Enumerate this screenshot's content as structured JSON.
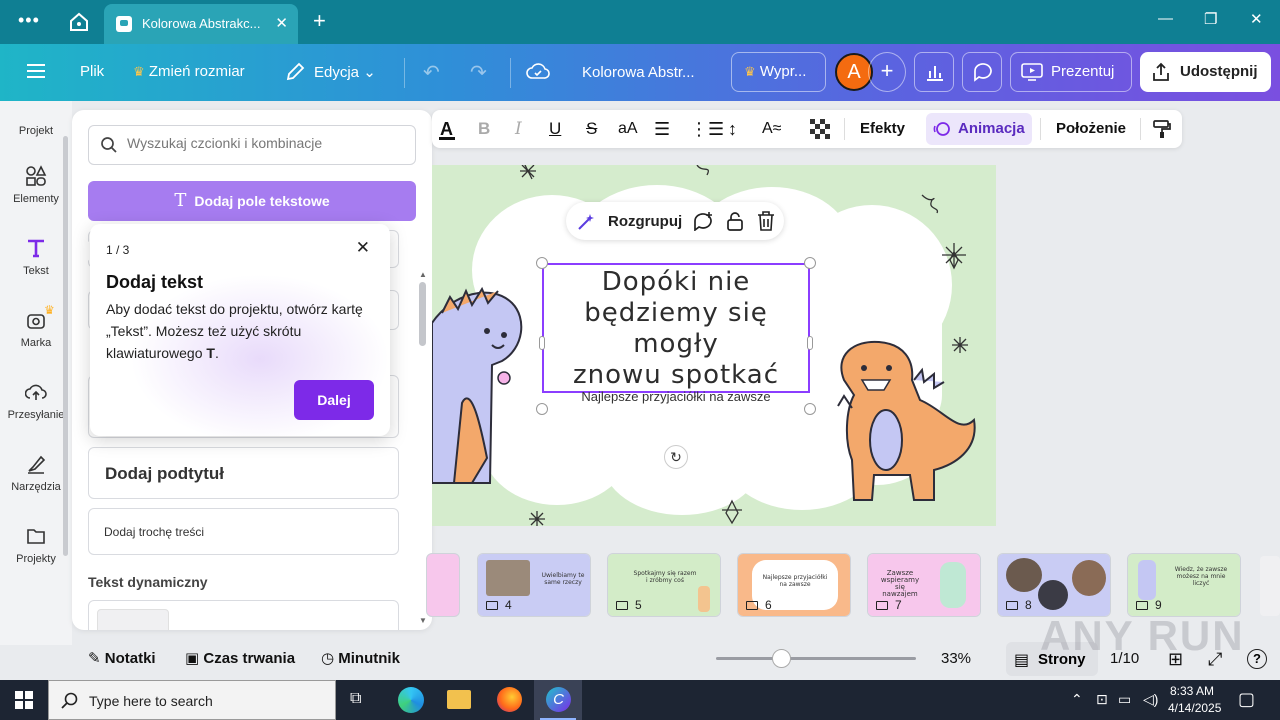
{
  "browser": {
    "tab_title": "Kolorowa Abstrakc...",
    "colors": {
      "tabbar": "#0f7f93",
      "active_tab": "#2aa4b6"
    }
  },
  "header": {
    "file_label": "Plik",
    "resize_label": "Zmień rozmiar",
    "edit_label": "Edycja",
    "doc_title": "Kolorowa Abstr...",
    "upgrade_label": "Wypr...",
    "avatar_letter": "A",
    "present_label": "Prezentuj",
    "share_label": "Udostępnij"
  },
  "rail": {
    "items": [
      {
        "label": "Projekt",
        "icon": "project-icon"
      },
      {
        "label": "Elementy",
        "icon": "elements-icon"
      },
      {
        "label": "Tekst",
        "icon": "text-icon"
      },
      {
        "label": "Marka",
        "icon": "brand-icon"
      },
      {
        "label": "Przesyłanie",
        "icon": "upload-icon"
      },
      {
        "label": "Narzędzia",
        "icon": "tools-icon"
      },
      {
        "label": "Projekty",
        "icon": "folder-icon"
      }
    ]
  },
  "panel": {
    "search_placeholder": "Wyszukaj czcionki i kombinacje",
    "add_textbox_label": "Dodaj pole tekstowe",
    "add_subtitle_label": "Dodaj podtytuł",
    "add_body_label": "Dodaj trochę treści",
    "dynamic_text_heading": "Tekst dynamiczny"
  },
  "tooltip": {
    "step": "1 / 3",
    "title": "Dodaj tekst",
    "body": "Aby dodać tekst do projektu, otwórz kartę „Tekst”. Możesz też użyć skrótu klawiaturowego",
    "shortcut": "T",
    "period": ".",
    "next_label": "Dalej"
  },
  "toolbar": {
    "case_label": "aA",
    "effects_label": "Efekty",
    "animation_label": "Animacja",
    "position_label": "Położenie"
  },
  "floatbar": {
    "ungroup_label": "Rozgrupuj"
  },
  "slide": {
    "title_line1": "Dopóki nie",
    "title_line2": "będziemy się mogły",
    "title_line3": "znowu spotkać",
    "subtitle": "Najlepsze przyjaciółki na zawsze"
  },
  "thumbnails": [
    {
      "num": "4",
      "text": "Uwielbiamy te same rzeczy",
      "bg": "#c9ccf4"
    },
    {
      "num": "5",
      "text": "Spotkajmy się razem i zróbmy coś",
      "bg": "#d3ecc8"
    },
    {
      "num": "6",
      "text": "Najlepsze przyjaciółki na zawsze",
      "bg": "#f9b98a"
    },
    {
      "num": "7",
      "text": "Zawsze wspieramy się nawzajem",
      "bg": "#f7c7ec"
    },
    {
      "num": "8",
      "text": "",
      "bg": "#c9ccf4"
    },
    {
      "num": "9",
      "text": "Wiedz, że zawsze możesz na mnie liczyć",
      "bg": "#d3ecc8"
    }
  ],
  "bottombar": {
    "notes_label": "Notatki",
    "duration_label": "Czas trwania",
    "timer_label": "Minutnik",
    "zoom": "33%",
    "pages_label": "Strony",
    "page_counter": "1/10"
  },
  "taskbar": {
    "search_placeholder": "Type here to search",
    "time": "8:33 AM",
    "date": "4/14/2025"
  },
  "watermark": "ANY RUN"
}
